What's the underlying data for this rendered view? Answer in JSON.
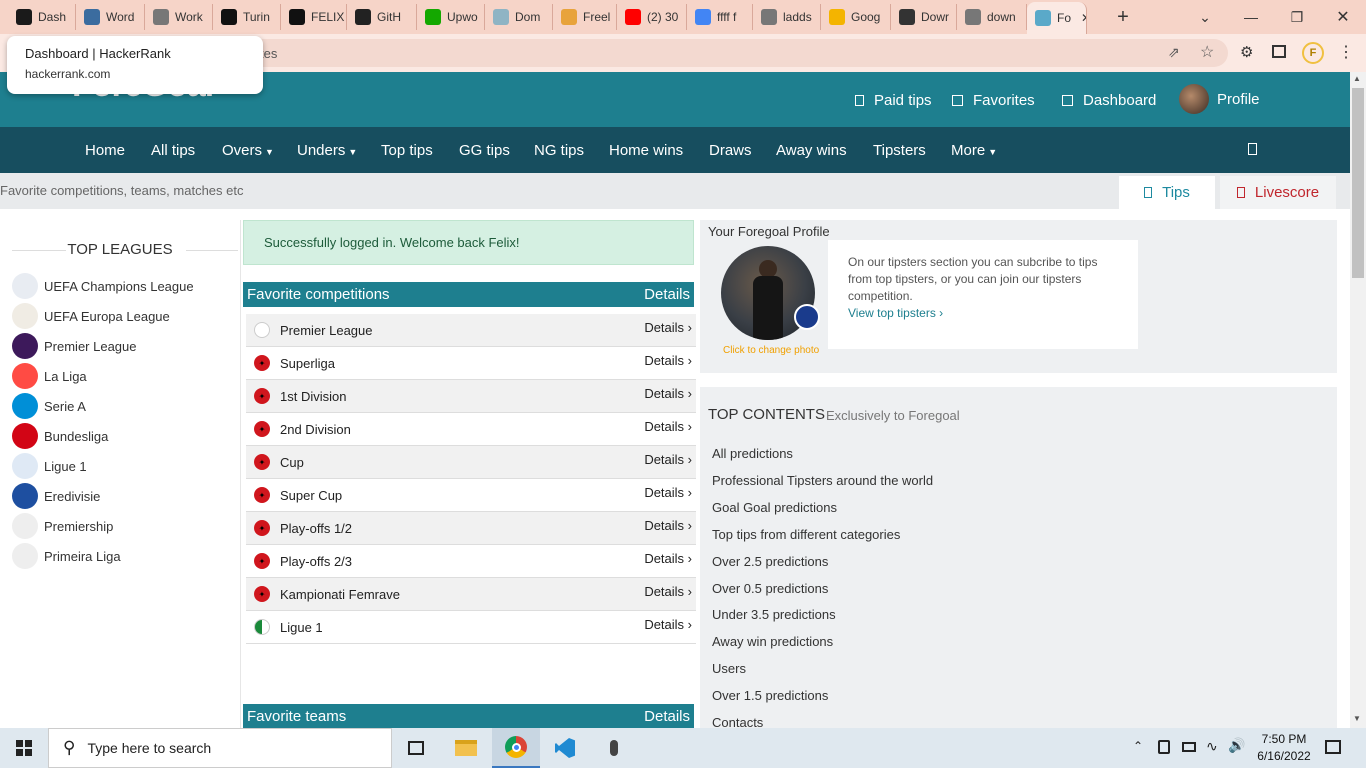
{
  "browser": {
    "tabs": [
      {
        "label": "Dash",
        "icon": "hackerrank-icon",
        "color": "#1a1a1a"
      },
      {
        "label": "Word",
        "icon": "wordpress-icon",
        "color": "#3b6c9f"
      },
      {
        "label": "Work",
        "icon": "globe-icon",
        "color": "#777777"
      },
      {
        "label": "Turin",
        "icon": "turing-icon",
        "color": "#111111"
      },
      {
        "label": "FELIX",
        "icon": "turing-icon",
        "color": "#111111"
      },
      {
        "label": "GitH",
        "icon": "github-icon",
        "color": "#222222"
      },
      {
        "label": "Upwo",
        "icon": "upwork-icon",
        "color": "#14a800"
      },
      {
        "label": "Dom",
        "icon": "domain-icon",
        "color": "#8fb4c4"
      },
      {
        "label": "Freel",
        "icon": "freelancer-icon",
        "color": "#e8a33b"
      },
      {
        "label": "(2) 30",
        "icon": "youtube-icon",
        "color": "#ff0000"
      },
      {
        "label": "ffff f",
        "icon": "google-icon",
        "color": "#4285f4"
      },
      {
        "label": "ladds",
        "icon": "globe-icon",
        "color": "#777777"
      },
      {
        "label": "Goog",
        "icon": "google-keep-icon",
        "color": "#f4b400"
      },
      {
        "label": "Dowr",
        "icon": "download-icon",
        "color": "#333333"
      },
      {
        "label": "down",
        "icon": "globe-icon",
        "color": "#777777"
      },
      {
        "label": "Fo",
        "icon": "foregoal-icon",
        "color": "#5aa9c9"
      }
    ],
    "address_text": "tes",
    "tooltip": {
      "title": "Dashboard | HackerRank",
      "url": "hackerrank.com"
    }
  },
  "site": {
    "logo": "ForeGoal",
    "header_links": {
      "paid_tips": "Paid tips",
      "favorites": "Favorites",
      "dashboard": "Dashboard",
      "profile": "Profile"
    },
    "nav": [
      "Home",
      "All tips",
      "Overs",
      "Unders",
      "Top tips",
      "GG tips",
      "NG tips",
      "Home wins",
      "Draws",
      "Away wins",
      "Tipsters",
      "More"
    ],
    "search_placeholder": "Favorite competitions, teams, matches etc",
    "tabs": {
      "tips": "Tips",
      "livescore": "Livescore"
    }
  },
  "top_leagues": {
    "title": "TOP LEAGUES",
    "items": [
      {
        "name": "UEFA Champions League",
        "icon": "champions-league-icon"
      },
      {
        "name": "UEFA Europa League",
        "icon": "europa-league-icon"
      },
      {
        "name": "Premier League",
        "icon": "premier-league-icon"
      },
      {
        "name": "La Liga",
        "icon": "la-liga-icon"
      },
      {
        "name": "Serie A",
        "icon": "serie-a-icon"
      },
      {
        "name": "Bundesliga",
        "icon": "bundesliga-icon"
      },
      {
        "name": "Ligue 1",
        "icon": "ligue-1-icon"
      },
      {
        "name": "Eredivisie",
        "icon": "eredivisie-icon"
      },
      {
        "name": "Premiership",
        "icon": "trophy-icon"
      },
      {
        "name": "Primeira Liga",
        "icon": "trophy-icon"
      }
    ]
  },
  "alert": "Successfully logged in. Welcome back Felix!",
  "favorite_competitions": {
    "title": "Favorite competitions",
    "details": "Details",
    "items": [
      {
        "name": "Premier League",
        "flag": "england-flag-icon",
        "details": "Details ›"
      },
      {
        "name": "Superliga",
        "flag": "albania-flag-icon",
        "details": "Details ›"
      },
      {
        "name": "1st Division",
        "flag": "albania-flag-icon",
        "details": "Details ›"
      },
      {
        "name": "2nd Division",
        "flag": "albania-flag-icon",
        "details": "Details ›"
      },
      {
        "name": "Cup",
        "flag": "albania-flag-icon",
        "details": "Details ›"
      },
      {
        "name": "Super Cup",
        "flag": "albania-flag-icon",
        "details": "Details ›"
      },
      {
        "name": "Play-offs 1/2",
        "flag": "albania-flag-icon",
        "details": "Details ›"
      },
      {
        "name": "Play-offs 2/3",
        "flag": "albania-flag-icon",
        "details": "Details ›"
      },
      {
        "name": "Kampionati Femrave",
        "flag": "albania-flag-icon",
        "details": "Details ›"
      },
      {
        "name": "Ligue 1",
        "flag": "algeria-flag-icon",
        "details": "Details ›"
      }
    ]
  },
  "favorite_teams": {
    "title": "Favorite teams",
    "details": "Details"
  },
  "profile": {
    "title": "Your Foregoal Profile",
    "change_photo": "Click to change photo",
    "tipsters_text": "On our tipsters section you can subcribe to tips from top tipsters, or you can join our tipsters competition.",
    "view_tipsters": "View top tipsters ›"
  },
  "top_contents": {
    "title": "TOP CONTENTS",
    "subtitle": "Exclusively to Foregoal",
    "items": [
      "All predictions",
      "Professional Tipsters around the world",
      "Goal Goal predictions",
      "Top tips from different categories",
      "Over 2.5 predictions",
      "Over 0.5 predictions",
      "Under 3.5 predictions",
      "Away win predictions",
      "Users",
      "Over 1.5 predictions",
      "Contacts"
    ]
  },
  "taskbar": {
    "search_placeholder": "Type here to search",
    "time": "7:50 PM",
    "date": "6/16/2022"
  },
  "colors": {
    "header": "#1e7f8f",
    "nav": "#174e5f",
    "accent_red": "#c0262d"
  }
}
